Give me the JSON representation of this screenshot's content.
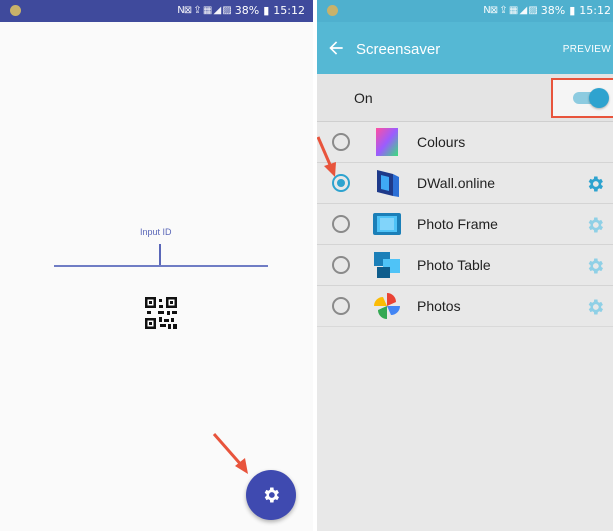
{
  "left_phone": {
    "status_bar": {
      "icons": "N⊠ ⇪ ▦ ◢ ▨",
      "battery": "38%",
      "time": "15:12"
    },
    "input": {
      "label": "Input ID"
    },
    "qr_icon": "qr-code-icon",
    "fab_icon": "gear-icon"
  },
  "right_phone": {
    "status_bar": {
      "icons": "N⊠ ⇪ ▦ ◢ ▨",
      "battery": "38%",
      "time": "15:12"
    },
    "app_bar": {
      "title": "Screensaver",
      "action": "PREVIEW"
    },
    "toggle": {
      "label": "On",
      "state": "on"
    },
    "items": [
      {
        "label": "Colours",
        "selected": false,
        "has_settings": false
      },
      {
        "label": "DWall.online",
        "selected": true,
        "has_settings": true
      },
      {
        "label": "Photo Frame",
        "selected": false,
        "has_settings": true
      },
      {
        "label": "Photo Table",
        "selected": false,
        "has_settings": true
      },
      {
        "label": "Photos",
        "selected": false,
        "has_settings": true
      }
    ]
  },
  "colors": {
    "left_status": "#3f4a9c",
    "fab": "#3f4ab0",
    "accent": "#2ea3cf",
    "app_bar": "#55b8d4",
    "annotation": "#e8543c"
  }
}
